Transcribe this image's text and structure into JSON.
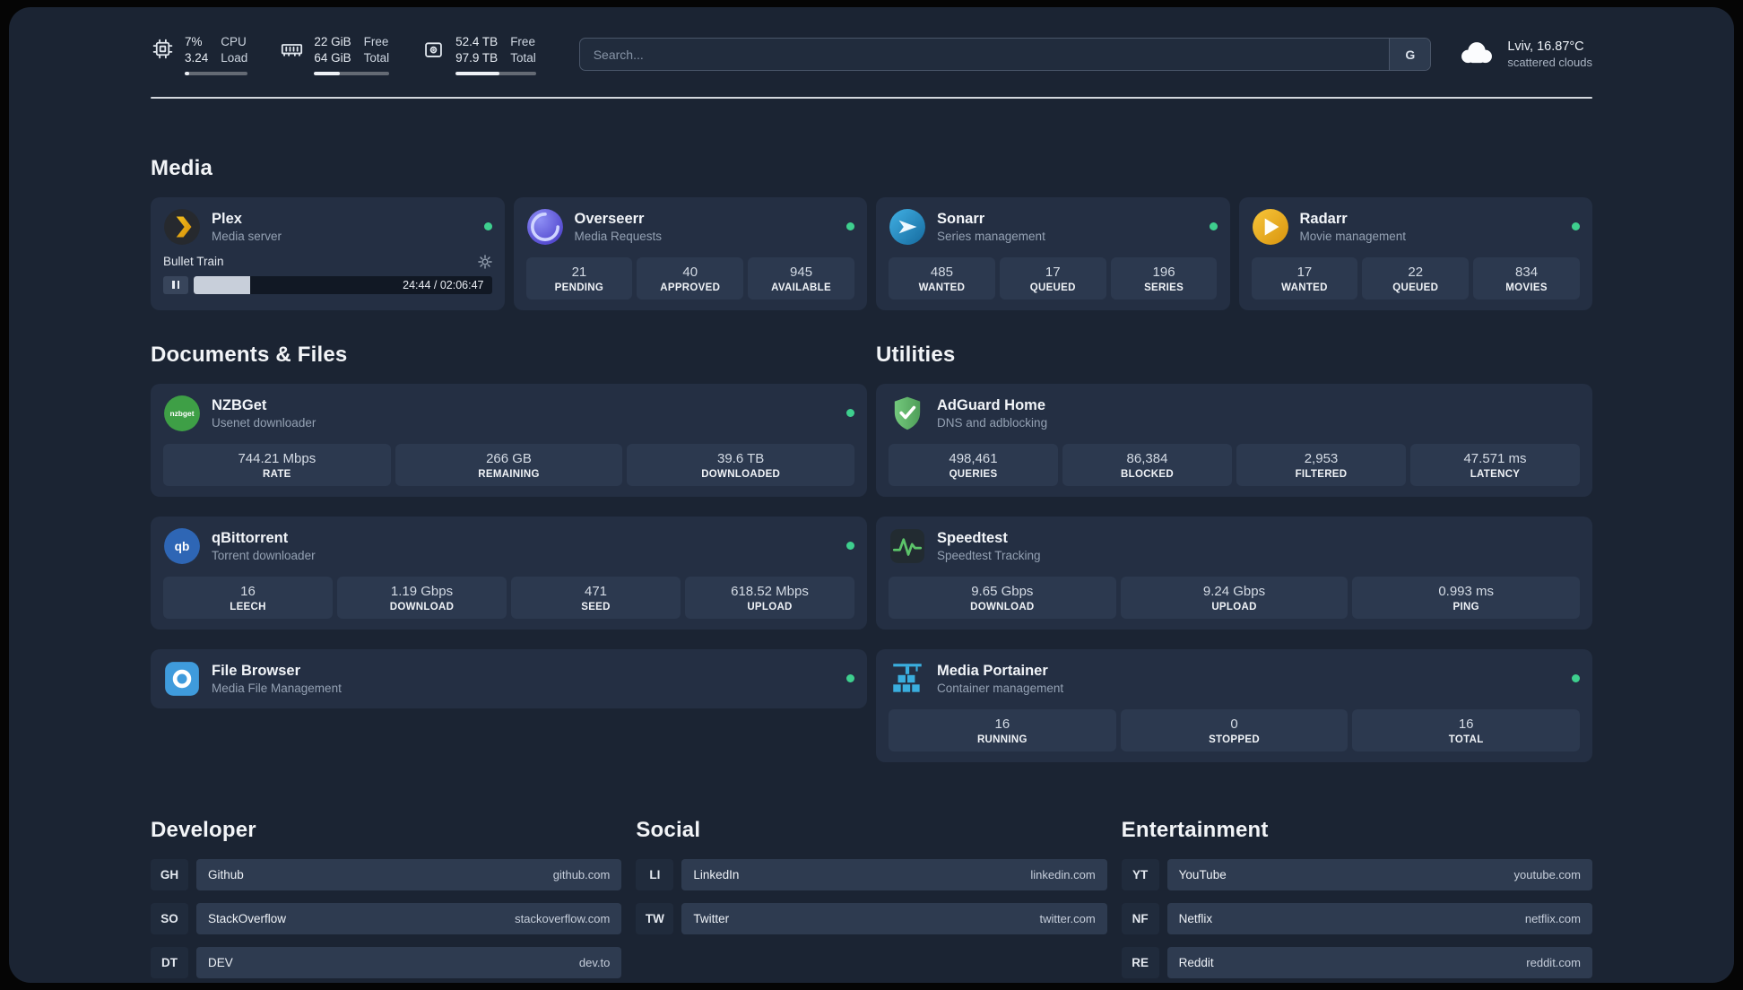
{
  "colors": {
    "page-bg": "#1b2433",
    "card-bg": "#242f43",
    "stat-bg": "#2c394f",
    "bar-bg": "#2e3b50",
    "badge-bg": "#202b3c",
    "status-online": "#3ecf8e",
    "divider": "#e3e7ec"
  },
  "topbar": {
    "cpu": {
      "value1": "7%",
      "value2": "3.24",
      "label1": "CPU",
      "label2": "Load",
      "progress_pct": 7
    },
    "ram": {
      "value1": "22 GiB",
      "value2": "64 GiB",
      "label1": "Free",
      "label2": "Total",
      "progress_pct": 34
    },
    "disk": {
      "value1": "52.4 TB",
      "value2": "97.9 TB",
      "label1": "Free",
      "label2": "Total",
      "progress_pct": 54
    },
    "search": {
      "placeholder": "Search...",
      "button_label": "G"
    },
    "weather": {
      "location": "Lviv, 16.87°C",
      "condition": "scattered clouds"
    }
  },
  "section_titles": {
    "media": "Media",
    "documents": "Documents & Files",
    "utilities": "Utilities",
    "developer": "Developer",
    "social": "Social",
    "entertainment": "Entertainment"
  },
  "apps": {
    "plex": {
      "name": "Plex",
      "subtitle": "Media server",
      "status": "online",
      "now_playing": {
        "title": "Bullet Train",
        "time": "24:44 / 02:06:47",
        "progress_pct": 19
      }
    },
    "overseerr": {
      "name": "Overseerr",
      "subtitle": "Media Requests",
      "status": "online",
      "stats": [
        {
          "value": "21",
          "label": "PENDING"
        },
        {
          "value": "40",
          "label": "APPROVED"
        },
        {
          "value": "945",
          "label": "AVAILABLE"
        }
      ]
    },
    "sonarr": {
      "name": "Sonarr",
      "subtitle": "Series management",
      "status": "online",
      "stats": [
        {
          "value": "485",
          "label": "WANTED"
        },
        {
          "value": "17",
          "label": "QUEUED"
        },
        {
          "value": "196",
          "label": "SERIES"
        }
      ]
    },
    "radarr": {
      "name": "Radarr",
      "subtitle": "Movie management",
      "status": "online",
      "stats": [
        {
          "value": "17",
          "label": "WANTED"
        },
        {
          "value": "22",
          "label": "QUEUED"
        },
        {
          "value": "834",
          "label": "MOVIES"
        }
      ]
    },
    "nzbget": {
      "name": "NZBGet",
      "subtitle": "Usenet downloader",
      "status": "online",
      "stats": [
        {
          "value": "744.21 Mbps",
          "label": "RATE"
        },
        {
          "value": "266 GB",
          "label": "REMAINING"
        },
        {
          "value": "39.6 TB",
          "label": "DOWNLOADED"
        }
      ]
    },
    "qbittorrent": {
      "name": "qBittorrent",
      "subtitle": "Torrent downloader",
      "status": "online",
      "stats": [
        {
          "value": "16",
          "label": "LEECH"
        },
        {
          "value": "1.19 Gbps",
          "label": "DOWNLOAD"
        },
        {
          "value": "471",
          "label": "SEED"
        },
        {
          "value": "618.52 Mbps",
          "label": "UPLOAD"
        }
      ]
    },
    "filebrowser": {
      "name": "File Browser",
      "subtitle": "Media File Management",
      "status": "online",
      "stats": []
    },
    "adguard": {
      "name": "AdGuard Home",
      "subtitle": "DNS and adblocking",
      "stats": [
        {
          "value": "498,461",
          "label": "QUERIES"
        },
        {
          "value": "86,384",
          "label": "BLOCKED"
        },
        {
          "value": "2,953",
          "label": "FILTERED"
        },
        {
          "value": "47.571 ms",
          "label": "LATENCY"
        }
      ]
    },
    "speedtest": {
      "name": "Speedtest",
      "subtitle": "Speedtest Tracking",
      "stats": [
        {
          "value": "9.65 Gbps",
          "label": "DOWNLOAD"
        },
        {
          "value": "9.24 Gbps",
          "label": "UPLOAD"
        },
        {
          "value": "0.993 ms",
          "label": "PING"
        }
      ]
    },
    "portainer": {
      "name": "Media Portainer",
      "subtitle": "Container management",
      "status": "online",
      "stats": [
        {
          "value": "16",
          "label": "RUNNING"
        },
        {
          "value": "0",
          "label": "STOPPED"
        },
        {
          "value": "16",
          "label": "TOTAL"
        }
      ]
    }
  },
  "links": {
    "developer": [
      {
        "abbr": "GH",
        "name": "Github",
        "domain": "github.com"
      },
      {
        "abbr": "SO",
        "name": "StackOverflow",
        "domain": "stackoverflow.com"
      },
      {
        "abbr": "DT",
        "name": "DEV",
        "domain": "dev.to"
      }
    ],
    "social": [
      {
        "abbr": "LI",
        "name": "LinkedIn",
        "domain": "linkedin.com"
      },
      {
        "abbr": "TW",
        "name": "Twitter",
        "domain": "twitter.com"
      }
    ],
    "entertainment": [
      {
        "abbr": "YT",
        "name": "YouTube",
        "domain": "youtube.com"
      },
      {
        "abbr": "NF",
        "name": "Netflix",
        "domain": "netflix.com"
      },
      {
        "abbr": "RE",
        "name": "Reddit",
        "domain": "reddit.com"
      }
    ]
  }
}
